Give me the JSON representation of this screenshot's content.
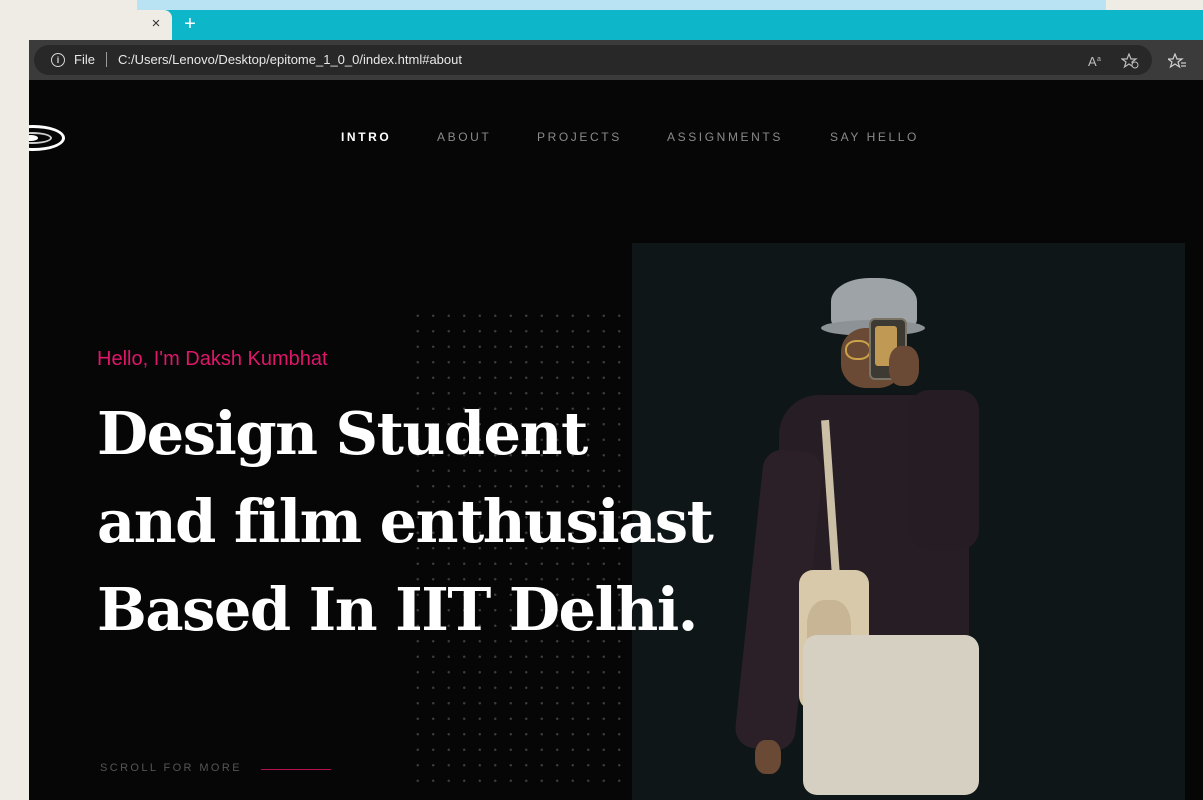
{
  "browser": {
    "address_prefix": "File",
    "url": "C:/Users/Lenovo/Desktop/epitome_1_0_0/index.html#about",
    "tab_close_symbol": "×",
    "new_tab_symbol": "+",
    "icons": {
      "info": "info-icon",
      "read_aloud": "read-aloud-icon",
      "add_favorite": "add-favorite-icon",
      "favorites": "favorites-icon"
    }
  },
  "nav": {
    "items": [
      {
        "label": "INTRO",
        "active": true
      },
      {
        "label": "ABOUT",
        "active": false
      },
      {
        "label": "PROJECTS",
        "active": false
      },
      {
        "label": "ASSIGNMENTS",
        "active": false
      },
      {
        "label": "SAY HELLO",
        "active": false
      }
    ]
  },
  "hero": {
    "greeting": "Hello, I'm Daksh Kumbhat",
    "headline_lines": [
      "Design Student",
      "and film enthusiast",
      "Based In IIT Delhi."
    ],
    "scroll_label": "SCROLL FOR MORE"
  },
  "colors": {
    "accent": "#e0166b",
    "tabstrip": "#0eb6c9",
    "page_background": "#060606",
    "photo_panel": "#0f1618"
  }
}
